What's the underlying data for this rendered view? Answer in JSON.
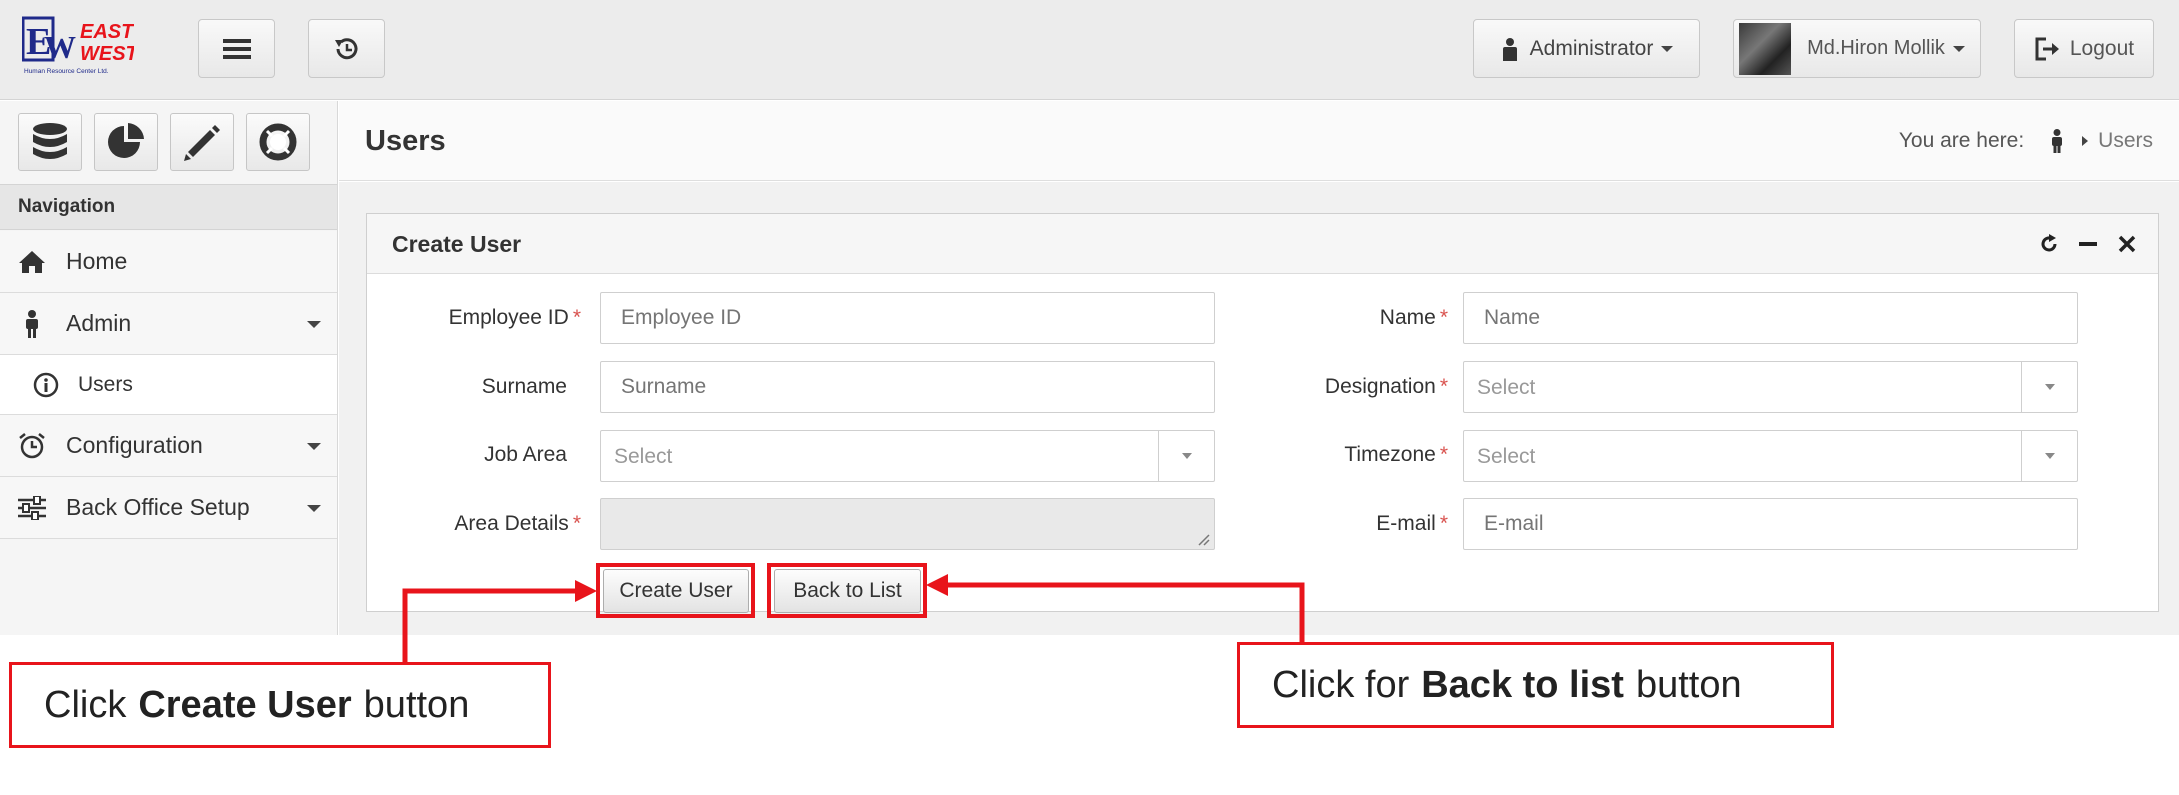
{
  "header": {
    "logo_top": "EAST",
    "logo_mid": "WEST",
    "logo_sub": "Human Resource Center Ltd.",
    "role_label": "Administrator",
    "user_name": "Md.Hiron Mollik",
    "logout_label": "Logout"
  },
  "sidebar": {
    "nav_title": "Navigation",
    "items": [
      {
        "label": "Home"
      },
      {
        "label": "Admin"
      },
      {
        "label": "Users"
      },
      {
        "label": "Configuration"
      },
      {
        "label": "Back Office Setup"
      }
    ]
  },
  "page": {
    "title": "Users",
    "breadcrumb_prefix": "You are here:",
    "breadcrumb_current": "Users"
  },
  "panel": {
    "title": "Create User",
    "fields": {
      "employee_id": {
        "label": "Employee ID",
        "placeholder": "Employee ID",
        "required": "*"
      },
      "surname": {
        "label": "Surname",
        "placeholder": "Surname"
      },
      "job_area": {
        "label": "Job Area",
        "value": "Select"
      },
      "area_details": {
        "label": "Area Details",
        "required": "*"
      },
      "name": {
        "label": "Name",
        "placeholder": "Name",
        "required": "*"
      },
      "designation": {
        "label": "Designation",
        "value": "Select",
        "required": "*"
      },
      "timezone": {
        "label": "Timezone",
        "value": "Select",
        "required": "*"
      },
      "email": {
        "label": "E-mail",
        "placeholder": "E-mail",
        "required": "*"
      }
    },
    "create_button": "Create User",
    "back_button": "Back to List"
  },
  "annotations": {
    "left_prefix": "Click",
    "left_bold": "Create User",
    "left_suffix": "button",
    "right_prefix": "Click for",
    "right_bold": "Back to list",
    "right_suffix": "button"
  },
  "colors": {
    "annotation_red": "#e8141b",
    "required_red": "#d9534f",
    "logo_blue": "#1f2a8a"
  }
}
